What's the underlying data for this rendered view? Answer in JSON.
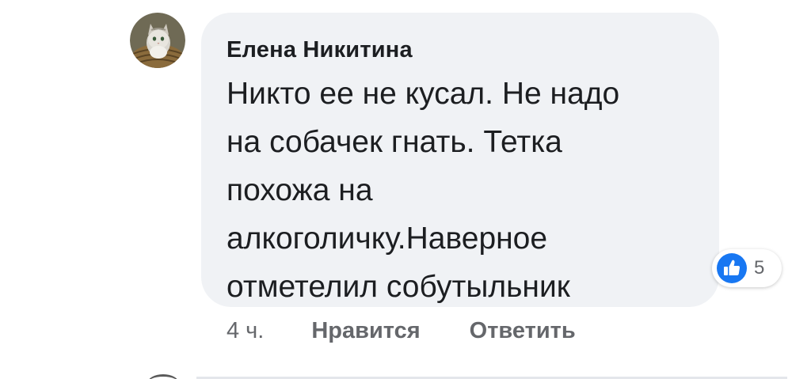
{
  "comment": {
    "author": "Елена Никитина",
    "text": "Никто ее не кусал. Не надо\nна собачек гнать. Тетка\nпохожа на\nалкоголичку.Наверное\nотметелил собутыльник",
    "avatar_icon": "cat-photo-avatar"
  },
  "reactions": {
    "icon": "thumbs-up-icon",
    "count": "5",
    "color": "#1877f2"
  },
  "actions": {
    "timestamp": "4 ч.",
    "like_label": "Нравится",
    "reply_label": "Ответить"
  },
  "colors": {
    "bubble": "#f0f2f5",
    "text": "#1c1e21",
    "secondary": "#65676b"
  }
}
